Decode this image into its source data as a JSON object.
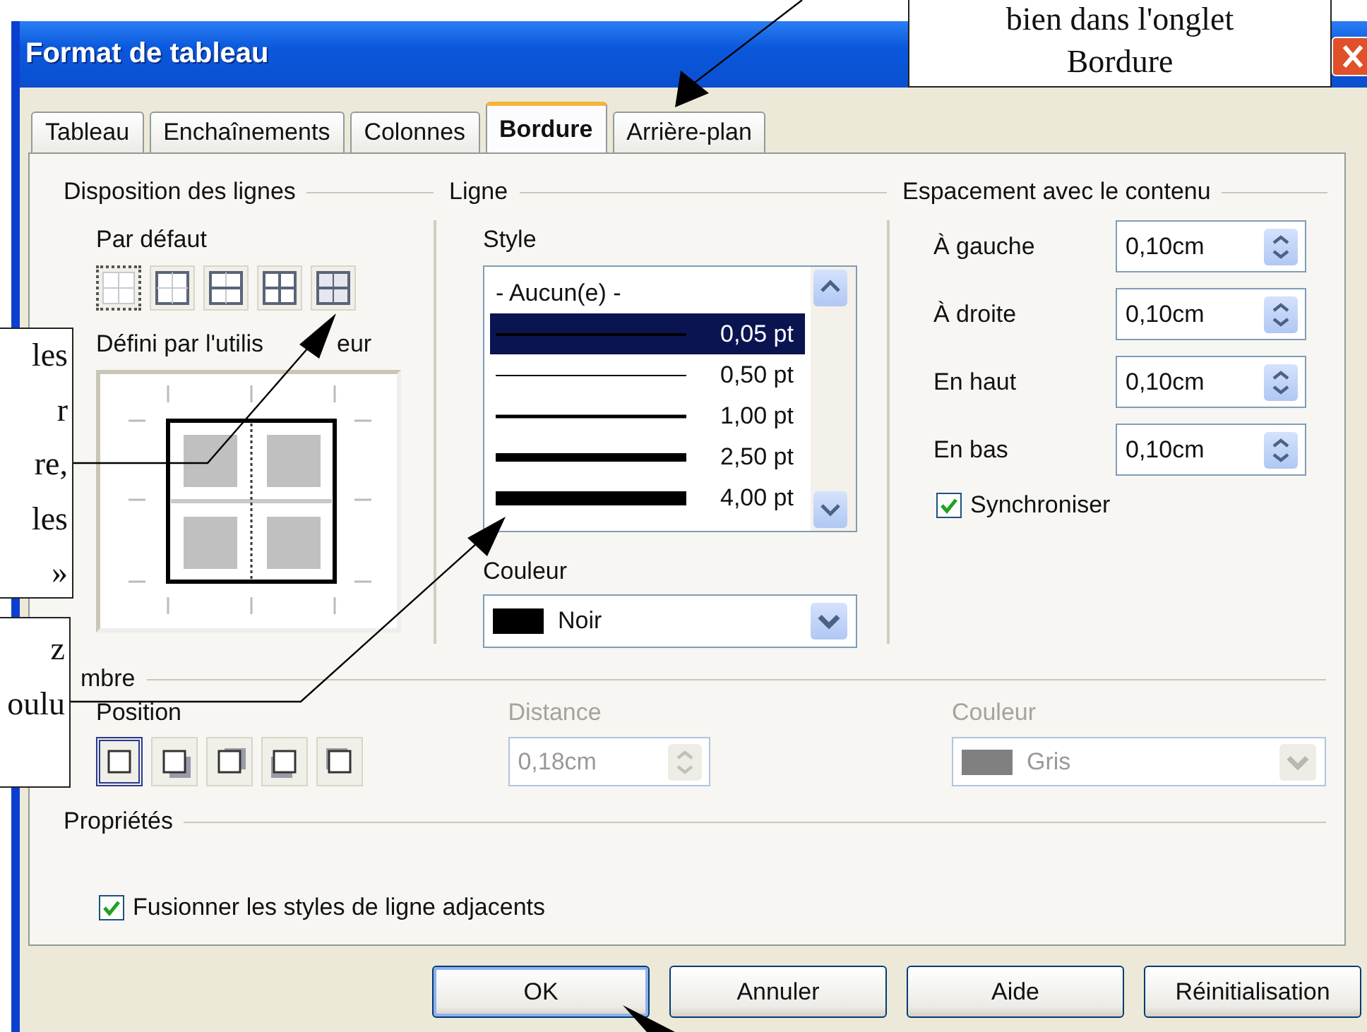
{
  "window": {
    "title": "Format de tableau"
  },
  "tabs": [
    {
      "label": "Tableau",
      "selected": false
    },
    {
      "label": "Enchaînements",
      "selected": false
    },
    {
      "label": "Colonnes",
      "selected": false
    },
    {
      "label": "Bordure",
      "selected": true
    },
    {
      "label": "Arrière-plan",
      "selected": false
    }
  ],
  "line_arrangement": {
    "title": "Disposition des lignes",
    "default_label": "Par défaut",
    "presets": [
      {
        "selected": true
      },
      {
        "selected": false
      },
      {
        "selected": false
      },
      {
        "selected": false
      },
      {
        "selected": false
      }
    ],
    "user_defined_label": [
      "Défini par l'utilis",
      "eur"
    ]
  },
  "line": {
    "title": "Ligne",
    "style_label": "Style",
    "styles": [
      {
        "kind": "none",
        "label": "- Aucun(e) -",
        "selected": false
      },
      {
        "kind": "line",
        "label": "0,05 pt",
        "selected": true
      },
      {
        "kind": "line",
        "label": "0,50 pt",
        "selected": false
      },
      {
        "kind": "line",
        "label": "1,00 pt",
        "selected": false
      },
      {
        "kind": "line",
        "label": "2,50 pt",
        "selected": false
      },
      {
        "kind": "line",
        "label": "4,00 pt",
        "selected": false
      }
    ],
    "color_label": "Couleur",
    "color_value": "Noir"
  },
  "spacing": {
    "title": "Espacement avec le contenu",
    "fields": [
      {
        "label": "À gauche",
        "value": "0,10cm"
      },
      {
        "label": "À droite",
        "value": "0,10cm"
      },
      {
        "label": "En haut",
        "value": "0,10cm"
      },
      {
        "label": "En bas",
        "value": "0,10cm"
      }
    ],
    "synchronize": {
      "label": "Synchroniser",
      "checked": true
    }
  },
  "shadow": {
    "title": "mbre",
    "position_label": "Position",
    "positions": [
      {
        "selected": true
      },
      {
        "selected": false
      },
      {
        "selected": false
      },
      {
        "selected": false
      },
      {
        "selected": false
      }
    ],
    "distance": {
      "label": "Distance",
      "value": "0,18cm",
      "disabled": true
    },
    "color": {
      "label": "Couleur",
      "value": "Gris",
      "disabled": true
    }
  },
  "properties": {
    "title": "Propriétés",
    "merge": {
      "label": "Fusionner les styles de ligne adjacents",
      "checked": true
    }
  },
  "buttons": [
    {
      "label": "OK",
      "default": true
    },
    {
      "label": "Annuler",
      "default": false
    },
    {
      "label": "Aide",
      "default": false
    },
    {
      "label": "Réinitialisation",
      "default": false
    }
  ],
  "callouts": [
    {
      "lines": [
        "bien dans l'onglet",
        "Bordure"
      ]
    },
    {
      "lines": [
        "les",
        "r",
        "re,",
        "les",
        "»"
      ]
    },
    {
      "lines": [
        "z",
        "oulu"
      ]
    }
  ]
}
